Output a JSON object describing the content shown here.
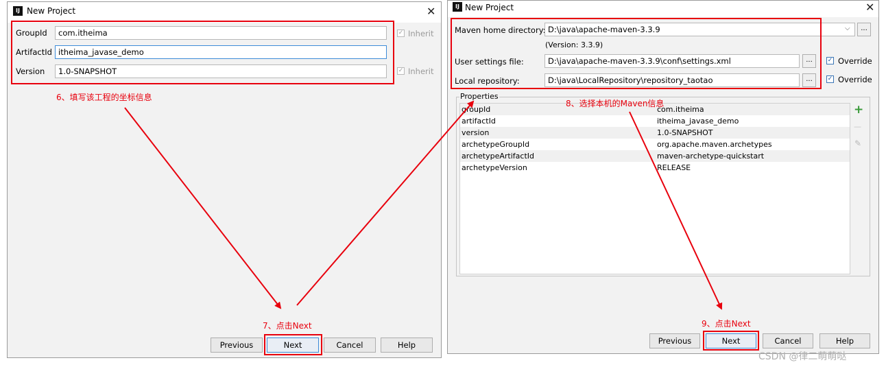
{
  "left_dialog": {
    "title": "New Project",
    "close": "✕",
    "fields": {
      "group_id": {
        "label": "GroupId",
        "value": "com.itheima",
        "inherit": "Inherit"
      },
      "artifact_id": {
        "label": "ArtifactId",
        "value": "itheima_javase_demo"
      },
      "version": {
        "label": "Version",
        "value": "1.0-SNAPSHOT",
        "inherit": "Inherit"
      }
    },
    "buttons": {
      "previous": "Previous",
      "next": "Next",
      "cancel": "Cancel",
      "help": "Help"
    }
  },
  "right_dialog": {
    "title": "New Project",
    "close": "✕",
    "maven_home": {
      "label": "Maven home directory:",
      "value": "D:\\java\\apache-maven-3.3.9",
      "version_note": "(Version: 3.3.9)"
    },
    "user_settings": {
      "label": "User settings file:",
      "value": "D:\\java\\apache-maven-3.3.9\\conf\\settings.xml",
      "browse": "...",
      "override": "Override"
    },
    "local_repo": {
      "label": "Local repository:",
      "value": "D:\\java\\LocalRepository\\repository_taotao",
      "browse": "...",
      "override": "Override"
    },
    "properties": {
      "legend": "Properties",
      "rows": [
        {
          "key": "groupId",
          "value": "com.itheima"
        },
        {
          "key": "artifactId",
          "value": "itheima_javase_demo"
        },
        {
          "key": "version",
          "value": "1.0-SNAPSHOT"
        },
        {
          "key": "archetypeGroupId",
          "value": "org.apache.maven.archetypes"
        },
        {
          "key": "archetypeArtifactId",
          "value": "maven-archetype-quickstart"
        },
        {
          "key": "archetypeVersion",
          "value": "RELEASE"
        }
      ],
      "add": "+",
      "remove": "—",
      "edit": "✎"
    },
    "buttons": {
      "previous": "Previous",
      "next": "Next",
      "cancel": "Cancel",
      "help": "Help"
    }
  },
  "annotations": {
    "step6": "6、填写该工程的坐标信息",
    "step7": "7、点击Next",
    "step8": "8、选择本机的Maven信息",
    "step9": "9、点击Next"
  },
  "watermark": "CSDN @律二萌萌哒",
  "colors": {
    "annotation_red": "#e8000d",
    "focus_blue": "#3d8bd8"
  }
}
